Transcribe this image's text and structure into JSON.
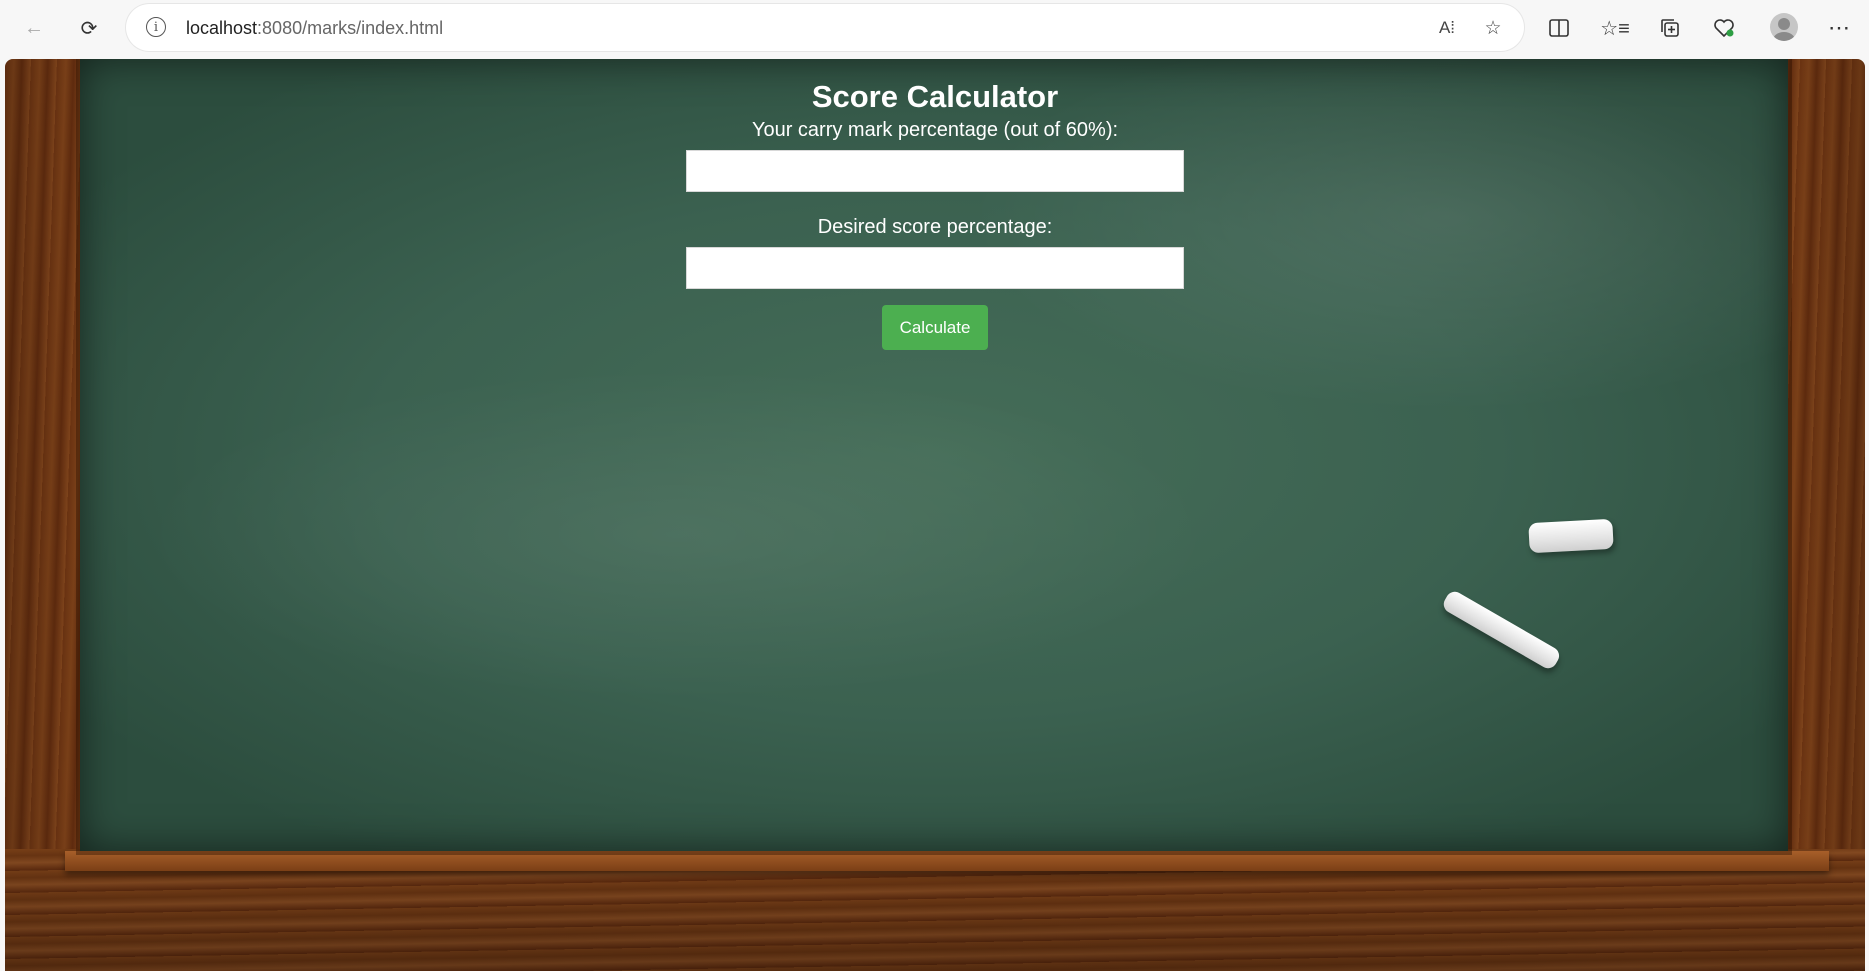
{
  "browser": {
    "url_host": "localhost",
    "url_path": ":8080/marks/index.html"
  },
  "page": {
    "title": "Score Calculator",
    "carry_label": "Your carry mark percentage (out of 60%):",
    "carry_value": "",
    "desired_label": "Desired score percentage:",
    "desired_value": "",
    "calculate_label": "Calculate"
  },
  "colors": {
    "button": "#4caf50",
    "board": "#3b6150"
  }
}
